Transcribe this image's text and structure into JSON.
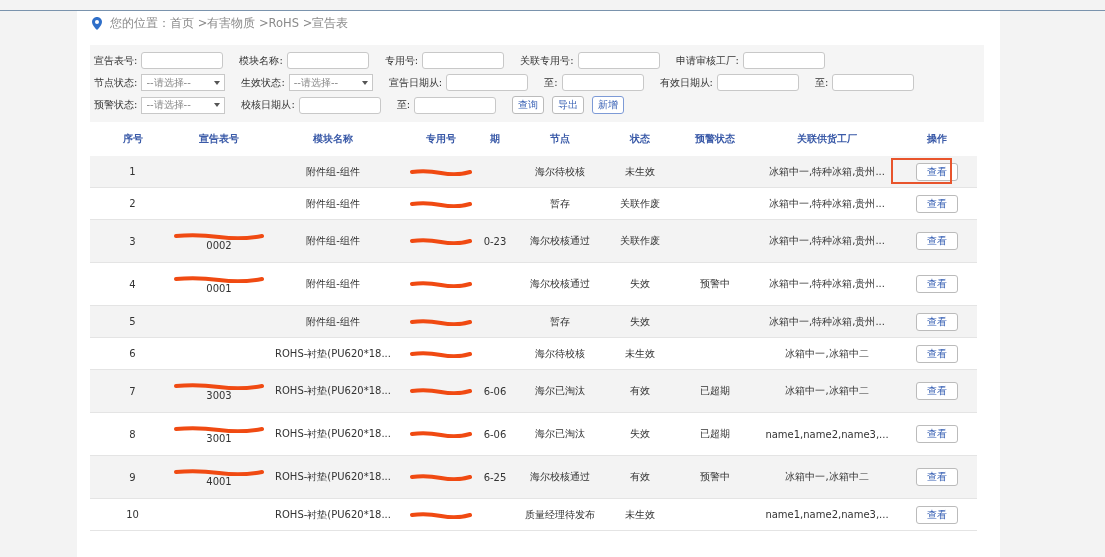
{
  "breadcrumb": "您的位置：首页 >有害物质 >RoHS >宣告表",
  "filters": [
    [
      {
        "kind": "input",
        "label": "宣告表号:"
      },
      {
        "kind": "input",
        "label": "模块名称:"
      },
      {
        "kind": "input",
        "label": "专用号:"
      },
      {
        "kind": "input",
        "label": "关联专用号:"
      },
      {
        "kind": "input",
        "label": "申请审核工厂:"
      }
    ],
    [
      {
        "kind": "select",
        "label": "节点状态:",
        "placeholder": "--请选择--"
      },
      {
        "kind": "select",
        "label": "生效状态:",
        "placeholder": "--请选择--"
      },
      {
        "kind": "input",
        "label": "宣告日期从:"
      },
      {
        "kind": "input",
        "label": "至:"
      },
      {
        "kind": "input",
        "label": "有效日期从:"
      },
      {
        "kind": "input",
        "label": "至:"
      }
    ],
    [
      {
        "kind": "select",
        "label": "预警状态:",
        "placeholder": "--请选择--"
      },
      {
        "kind": "input",
        "label": "校核日期从:"
      },
      {
        "kind": "input",
        "label": "至:"
      }
    ]
  ],
  "buttons": [
    {
      "label": "查询",
      "primary": false
    },
    {
      "label": "导出",
      "primary": false
    },
    {
      "label": "新增",
      "primary": true
    }
  ],
  "table": {
    "columns": [
      "序号",
      "宣告表号",
      "模块名称",
      "专用号",
      "期",
      "节点",
      "状态",
      "预警状态",
      "关联供货工厂",
      "操作"
    ],
    "rows": [
      {
        "no": "1",
        "report_no": {
          "redacted": false
        },
        "module": "附件组-组件",
        "special_no_redacted": true,
        "date": "",
        "node": "海尔待校核",
        "status": "未生效",
        "warning": "",
        "factories": "冰箱中一,特种冰箱,贵州...",
        "action": "查看",
        "highlighted": true
      },
      {
        "no": "2",
        "report_no": {
          "redacted": false
        },
        "module": "附件组-组件",
        "special_no_redacted": true,
        "date": "",
        "node": "暂存",
        "status": "关联作废",
        "warning": "",
        "factories": "冰箱中一,特种冰箱,贵州...",
        "action": "查看",
        "highlighted": false
      },
      {
        "no": "3",
        "report_no": {
          "redacted": true,
          "tail": "0002"
        },
        "module": "附件组-组件",
        "special_no_redacted": true,
        "date": "0-23",
        "node": "海尔校核通过",
        "status": "关联作废",
        "warning": "",
        "factories": "冰箱中一,特种冰箱,贵州...",
        "action": "查看",
        "highlighted": false
      },
      {
        "no": "4",
        "report_no": {
          "redacted": true,
          "tail": "0001"
        },
        "module": "附件组-组件",
        "special_no_redacted": true,
        "date": "",
        "node": "海尔校核通过",
        "status": "失效",
        "warning": "预警中",
        "factories": "冰箱中一,特种冰箱,贵州...",
        "action": "查看",
        "highlighted": false
      },
      {
        "no": "5",
        "report_no": {
          "redacted": false
        },
        "module": "附件组-组件",
        "special_no_redacted": true,
        "date": "",
        "node": "暂存",
        "status": "失效",
        "warning": "",
        "factories": "冰箱中一,特种冰箱,贵州...",
        "action": "查看",
        "highlighted": false
      },
      {
        "no": "6",
        "report_no": {
          "redacted": false
        },
        "module": "ROHS-衬垫(PU620*18...",
        "special_no_redacted": true,
        "date": "",
        "node": "海尔待校核",
        "status": "未生效",
        "warning": "",
        "factories": "冰箱中一,冰箱中二",
        "action": "查看",
        "highlighted": false
      },
      {
        "no": "7",
        "report_no": {
          "redacted": true,
          "tail": "3003"
        },
        "module": "ROHS-衬垫(PU620*18...",
        "special_no_redacted": true,
        "date": "6-06",
        "node": "海尔已淘汰",
        "status": "有效",
        "warning": "已超期",
        "factories": "冰箱中一,冰箱中二",
        "action": "查看",
        "highlighted": false
      },
      {
        "no": "8",
        "report_no": {
          "redacted": true,
          "tail": "3001"
        },
        "module": "ROHS-衬垫(PU620*18...",
        "special_no_redacted": true,
        "date": "6-06",
        "node": "海尔已淘汰",
        "status": "失效",
        "warning": "已超期",
        "factories": "name1,name2,name3,...",
        "action": "查看",
        "highlighted": false
      },
      {
        "no": "9",
        "report_no": {
          "redacted": true,
          "tail": "4001"
        },
        "module": "ROHS-衬垫(PU620*18...",
        "special_no_redacted": true,
        "date": "6-25",
        "node": "海尔校核通过",
        "status": "有效",
        "warning": "预警中",
        "factories": "冰箱中一,冰箱中二",
        "action": "查看",
        "highlighted": false
      },
      {
        "no": "10",
        "report_no": {
          "redacted": false
        },
        "module": "ROHS-衬垫(PU620*18...",
        "special_no_redacted": true,
        "date": "",
        "node": "质量经理待发布",
        "status": "未生效",
        "warning": "",
        "factories": "name1,name2,name3,...",
        "action": "查看",
        "highlighted": false
      }
    ]
  }
}
